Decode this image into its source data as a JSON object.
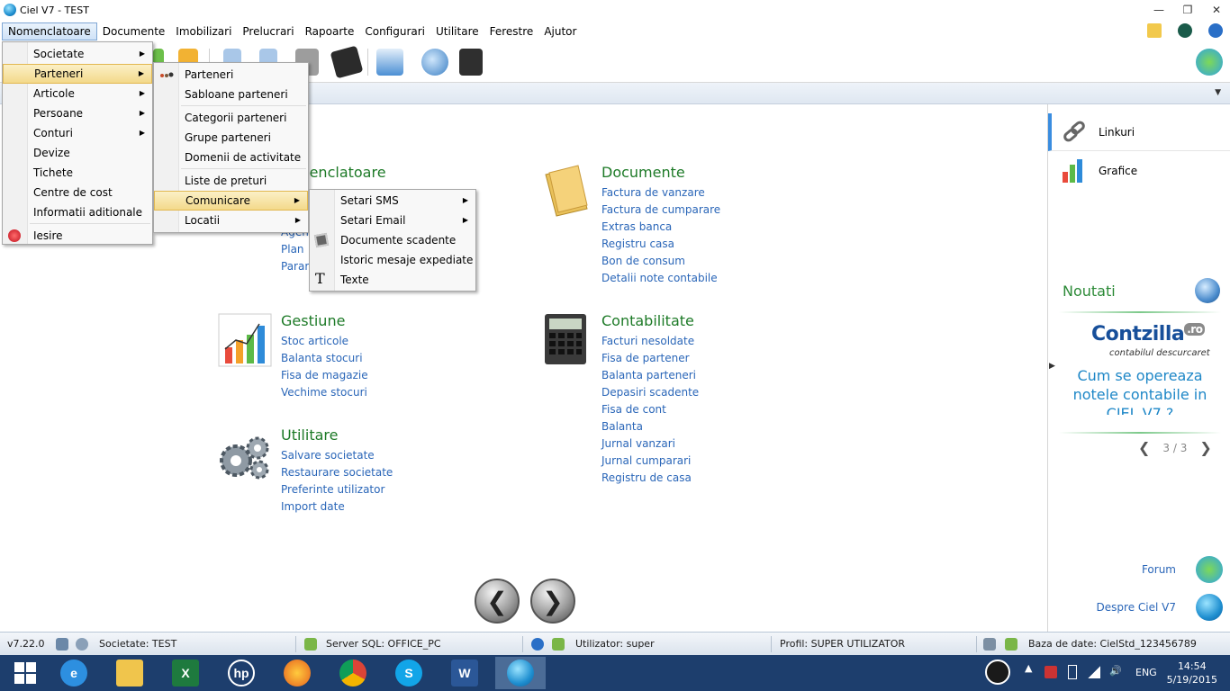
{
  "window": {
    "title": "Ciel V7 - TEST"
  },
  "menubar": {
    "items": [
      "Nomenclatoare",
      "Documente",
      "Imobilizari",
      "Prelucrari",
      "Rapoarte",
      "Configurari",
      "Utilitare",
      "Ferestre",
      "Ajutor"
    ]
  },
  "menus": {
    "nomenclatoare": [
      "Societate",
      "Parteneri",
      "Articole",
      "Persoane",
      "Conturi",
      "Devize",
      "Tichete",
      "Centre de cost",
      "Informatii aditionale",
      "Iesire"
    ],
    "parteneri": [
      "Parteneri",
      "Sabloane parteneri",
      "Categorii parteneri",
      "Grupe parteneri",
      "Domenii de activitate",
      "Liste de preturi",
      "Comunicare",
      "Locatii"
    ],
    "comunicare": [
      "Setari SMS",
      "Setari Email",
      "Documente scadente",
      "Istoric mesaje expediate",
      "Texte"
    ]
  },
  "sections": {
    "nomenclatoare": {
      "title": "menclatoare",
      "links": [
        "Agen",
        "Plan",
        "Parar"
      ]
    },
    "documente": {
      "title": "Documente",
      "links": [
        "Factura de vanzare",
        "Factura de cumparare",
        "Extras banca",
        "Registru casa",
        "Bon de consum",
        "Detalii note contabile"
      ]
    },
    "gestiune": {
      "title": "Gestiune",
      "links": [
        "Stoc articole",
        "Balanta stocuri",
        "Fisa de magazie",
        "Vechime stocuri"
      ]
    },
    "contabilitate": {
      "title": "Contabilitate",
      "links": [
        "Facturi nesoldate",
        "Fisa de partener",
        "Balanta parteneri",
        "Depasiri scadente",
        "Fisa de cont",
        "Balanta",
        "Jurnal vanzari",
        "Jurnal cumparari",
        "Registru de casa"
      ]
    },
    "utilitare": {
      "title": "Utilitare",
      "links": [
        "Salvare societate",
        "Restaurare societate",
        "Preferinte utilizator",
        "Import date"
      ]
    }
  },
  "rpanel": {
    "links": [
      "Linkuri",
      "Grafice"
    ],
    "noutati": "Noutati",
    "brand": "Contzilla",
    "brand_suffix": ".ro",
    "brand_tagline": "contabilul descurcaret",
    "news_text": "Cum se opereaza notele contabile in CIEL V7 ?",
    "pager": "3 / 3",
    "forum": "Forum",
    "despre": "Despre Ciel V7"
  },
  "statusbar": {
    "version": "v7.22.0",
    "societate": "Societate: TEST",
    "server": "Server SQL: OFFICE_PC",
    "utilizator": "Utilizator: super",
    "profil": "Profil: SUPER UTILIZATOR",
    "baza": "Baza de date: CielStd_123456789"
  },
  "taskbar": {
    "lang": "ENG",
    "time": "14:54",
    "date": "5/19/2015"
  },
  "colors": {
    "accent": "#1d7a27",
    "link": "#2a66b8",
    "taskbar": "#1d3e6d"
  }
}
